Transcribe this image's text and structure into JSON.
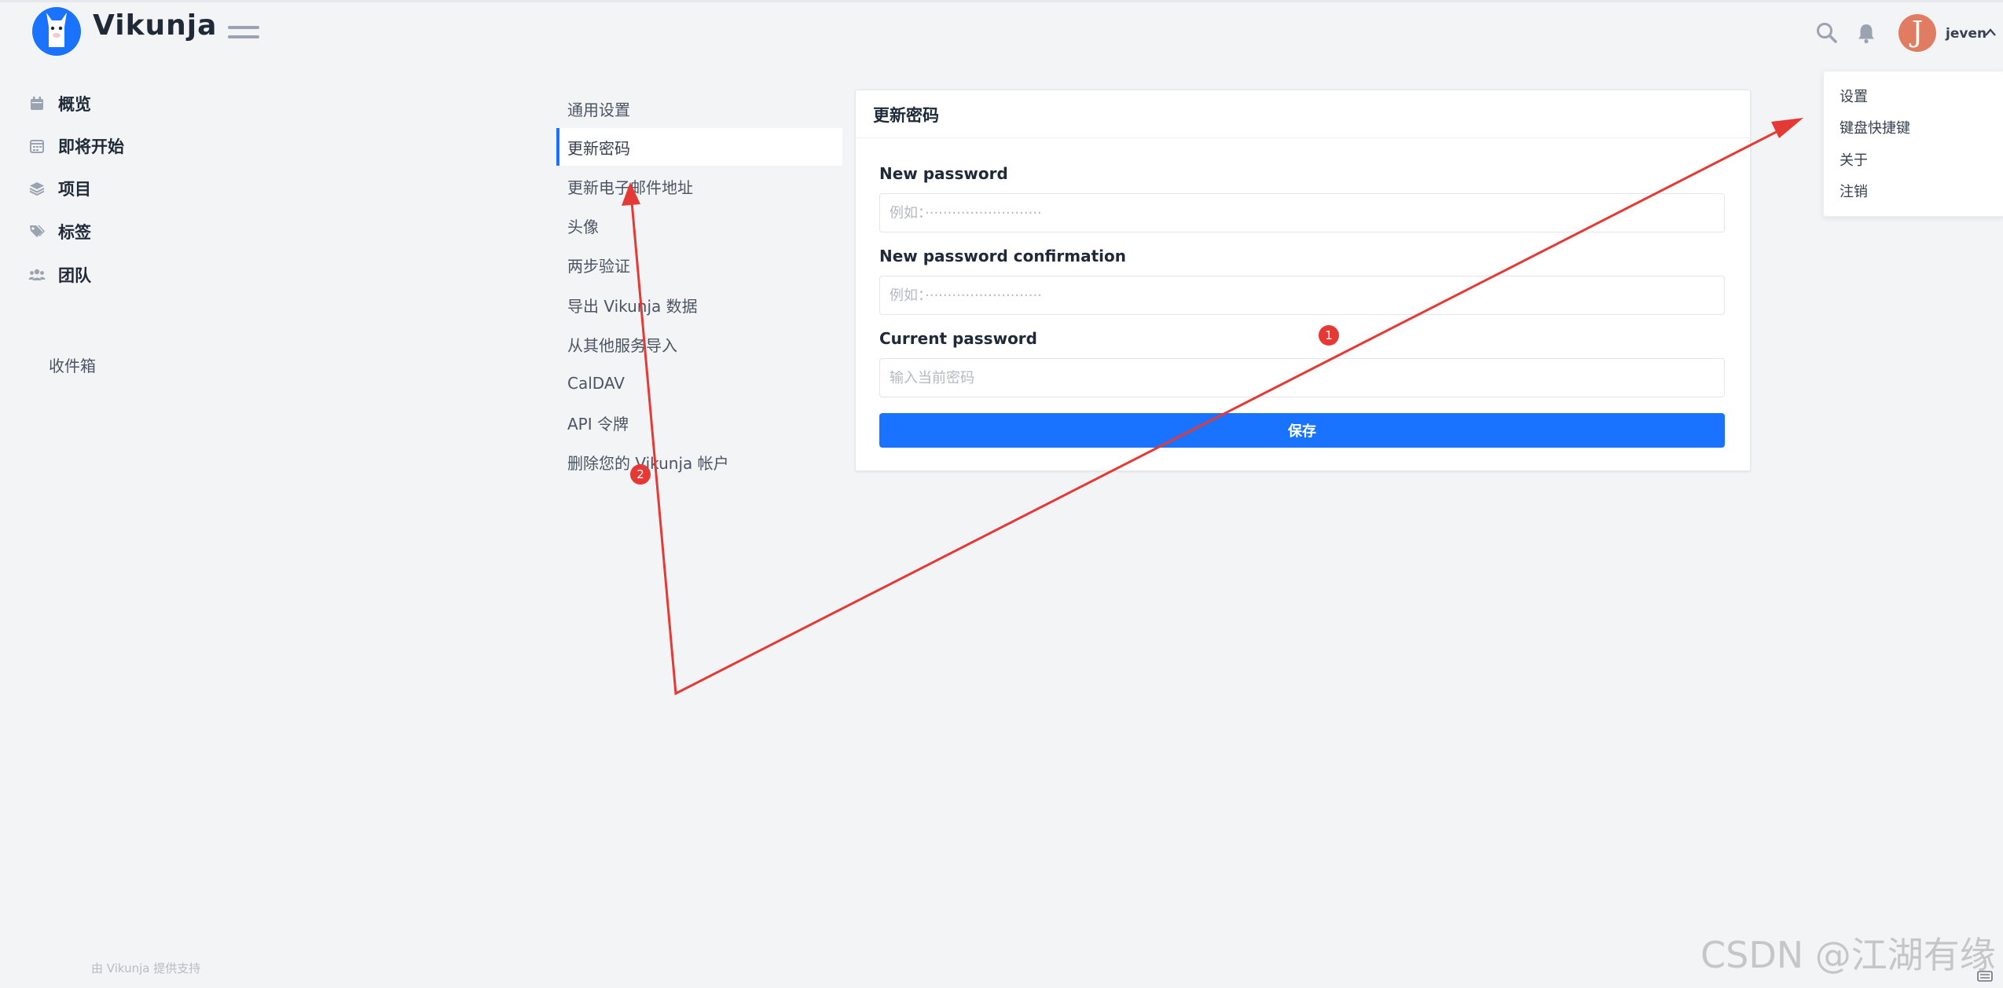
{
  "app": {
    "name": "Vikunja"
  },
  "header": {
    "icons": [
      "search-icon",
      "bell-icon",
      "chevron-up-icon"
    ],
    "avatar_letter": "J",
    "username": "jeven"
  },
  "sidebar": {
    "items": [
      {
        "label": "概览",
        "icon": "calendar-icon"
      },
      {
        "label": "即将开始",
        "icon": "calendar-grid-icon"
      },
      {
        "label": "项目",
        "icon": "layers-icon"
      },
      {
        "label": "标签",
        "icon": "tags-icon"
      },
      {
        "label": "团队",
        "icon": "users-icon"
      }
    ],
    "inbox": "收件箱"
  },
  "settings_nav": {
    "active_index": 1,
    "items": [
      "通用设置",
      "更新密码",
      "更新电子邮件地址",
      "头像",
      "两步验证",
      "导出 Vikunja 数据",
      "从其他服务导入",
      "CalDAV",
      "API 令牌",
      "删除您的 Vikunja 帐户"
    ]
  },
  "card": {
    "title": "更新密码",
    "fields": [
      {
        "label": "New password",
        "value": "",
        "placeholder": "例如：··························"
      },
      {
        "label": "New password confirmation",
        "value": "",
        "placeholder": "例如：··························"
      },
      {
        "label": "Current password",
        "value": "",
        "placeholder": "输入当前密码"
      }
    ],
    "save_label": "保存"
  },
  "dropdown": {
    "items": [
      "设置",
      "键盘快捷键",
      "关于",
      "注销"
    ]
  },
  "footer": {
    "text": "由 Vikunja 提供支持"
  },
  "watermark": "CSDN @江湖有缘",
  "annotations": {
    "badge_1": "1",
    "badge_2": "2"
  },
  "colors": {
    "primary": "#1973ff",
    "background": "#f3f4f6",
    "annotation": "#e53935",
    "avatar": "#e07c62"
  }
}
